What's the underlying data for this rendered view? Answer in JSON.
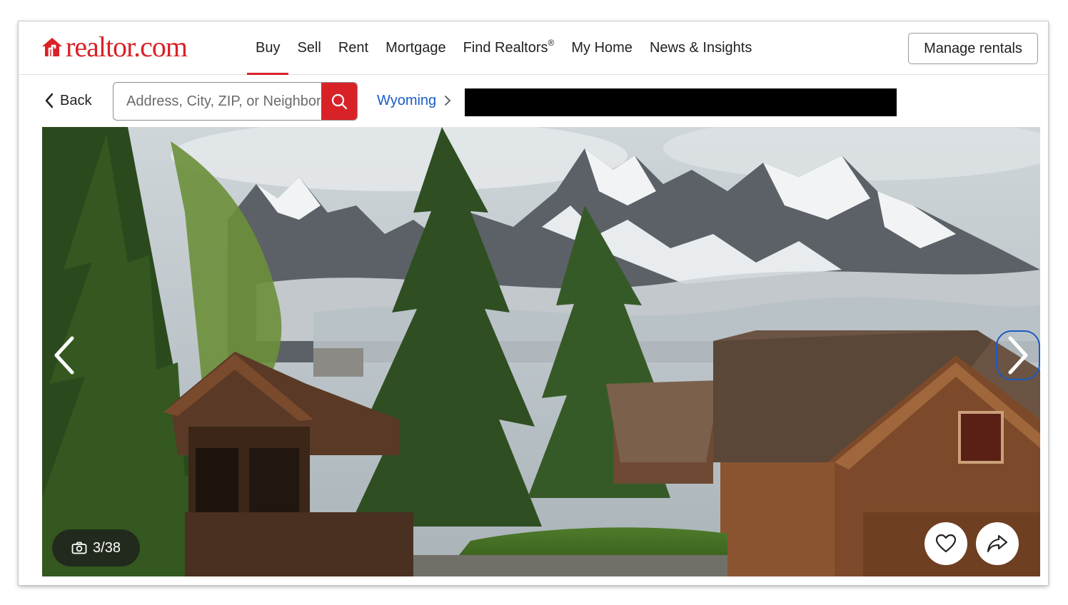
{
  "brand": {
    "logo_text": "realtor.com",
    "accent_color": "#d92228",
    "link_color": "#1a5bc4"
  },
  "nav": {
    "items": [
      {
        "label": "Buy",
        "active": true
      },
      {
        "label": "Sell"
      },
      {
        "label": "Rent"
      },
      {
        "label": "Mortgage"
      },
      {
        "label": "Find Realtors",
        "sup": "®"
      },
      {
        "label": "My Home"
      },
      {
        "label": "News & Insights"
      }
    ],
    "manage_label": "Manage rentals"
  },
  "subbar": {
    "back_label": "Back",
    "search_placeholder": "Address, City, ZIP, or Neighborhood",
    "breadcrumb": "Wyoming"
  },
  "gallery": {
    "counter": "3/38",
    "icons": {
      "prev": "chevron-left-icon",
      "next": "chevron-right-icon",
      "camera": "camera-icon",
      "favorite": "heart-icon",
      "share": "share-arrow-icon",
      "search": "search-icon"
    }
  }
}
